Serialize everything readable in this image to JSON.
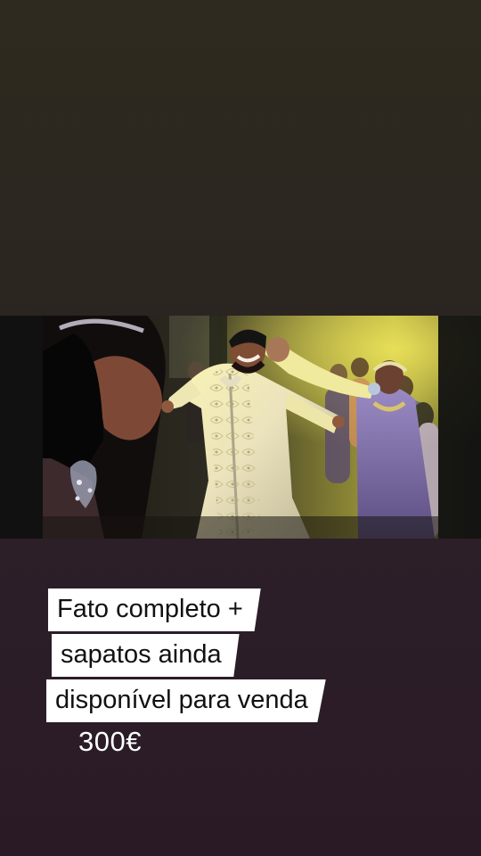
{
  "story": {
    "photo": {
      "subject": "wedding-dance-photo"
    },
    "caption": {
      "lines": [
        "Fato completo +",
        "sapatos ainda",
        "disponível para venda"
      ]
    },
    "price": "300€"
  },
  "colors": {
    "background_top": "#2e2a1f",
    "background_bottom": "#2a1a26",
    "caption_background": "#ffffff",
    "caption_text": "#111111",
    "price_text": "#ffffff"
  }
}
